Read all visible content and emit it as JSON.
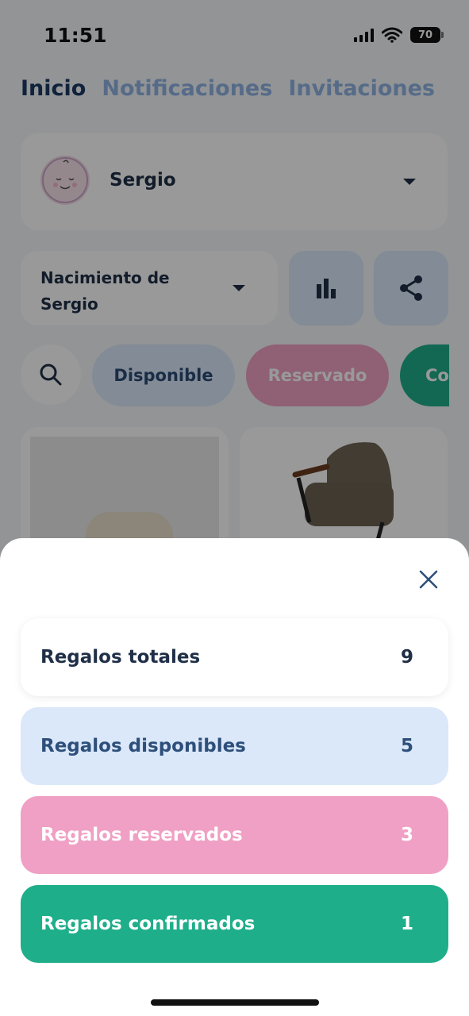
{
  "status_bar": {
    "time": "11:51",
    "battery": "70"
  },
  "tabs": [
    {
      "label": "Inicio",
      "active": true
    },
    {
      "label": "Notificaciones",
      "active": false
    },
    {
      "label": "Invitaciones",
      "active": false
    }
  ],
  "profile": {
    "name": "Sergio"
  },
  "event": {
    "name": "Nacimiento de Sergio"
  },
  "filters": {
    "available": "Disponible",
    "reserved": "Reservado",
    "confirmed": "Con"
  },
  "sheet": {
    "rows": [
      {
        "label": "Regalos totales",
        "value": "9"
      },
      {
        "label": "Regalos disponibles",
        "value": "5"
      },
      {
        "label": "Regalos reservados",
        "value": "3"
      },
      {
        "label": "Regalos confirmados",
        "value": "1"
      }
    ]
  },
  "colors": {
    "navy": "#1f2f47",
    "light_blue": "#dbe8fa",
    "pink": "#f0a0c4",
    "green": "#1fae8a"
  },
  "icons": {
    "avatar": "baby-face-icon",
    "stats": "bar-chart-icon",
    "share": "share-icon",
    "search": "search-icon",
    "close": "close-icon"
  }
}
